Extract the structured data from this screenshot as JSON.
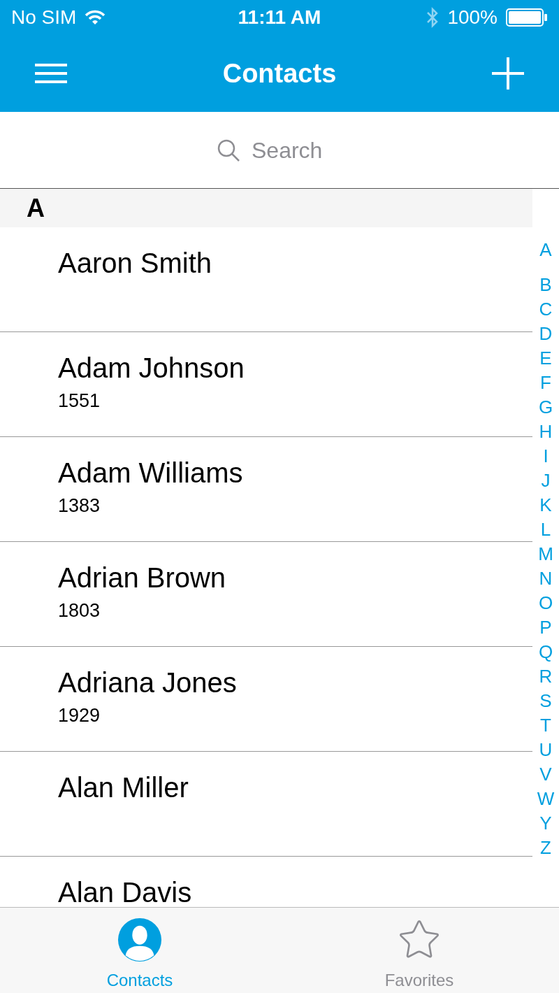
{
  "status_bar": {
    "carrier": "No SIM",
    "time": "11:11 AM",
    "battery": "100%"
  },
  "nav_bar": {
    "title": "Contacts"
  },
  "search": {
    "placeholder": "Search"
  },
  "sections": [
    {
      "letter": "A",
      "contacts": [
        {
          "name": "Aaron Smith"
        },
        {
          "name": "Adam Johnson",
          "number": "1551"
        },
        {
          "name": "Adam Williams",
          "number": "1383"
        },
        {
          "name": "Adrian Brown",
          "number": "1803"
        },
        {
          "name": "Adriana Jones",
          "number": "1929"
        },
        {
          "name": "Alan Miller"
        },
        {
          "name": "Alan Davis"
        }
      ]
    }
  ],
  "index": [
    "A",
    "B",
    "C",
    "D",
    "E",
    "F",
    "G",
    "H",
    "I",
    "J",
    "K",
    "L",
    "M",
    "N",
    "O",
    "P",
    "Q",
    "R",
    "S",
    "T",
    "U",
    "V",
    "W",
    "Y",
    "Z"
  ],
  "tabs": [
    {
      "kind": "contacts",
      "label": "Contacts",
      "selected": true
    },
    {
      "kind": "favorites",
      "label": "Favorites",
      "selected": false
    }
  ]
}
